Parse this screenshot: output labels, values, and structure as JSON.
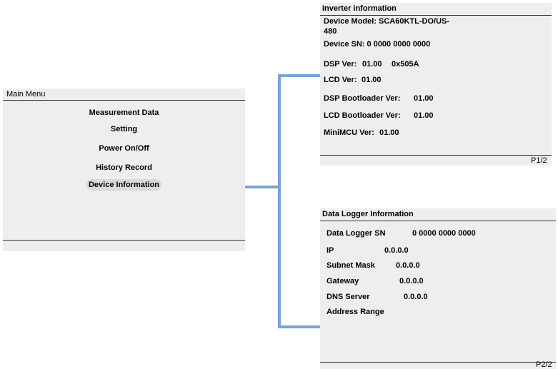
{
  "main_menu": {
    "title": "Main Menu",
    "items": [
      {
        "label": "Measurement Data"
      },
      {
        "label": "Setting"
      },
      {
        "label": "Power On/Off"
      },
      {
        "label": "History Record"
      },
      {
        "label": "Device Information",
        "selected": true
      }
    ]
  },
  "inverter_info": {
    "title": "Inverter information",
    "device_model_label": "Device Model: SCA60KTL-DO/US-",
    "device_model_cont": "480",
    "device_sn": "Device SN: 0 0000 0000 0000",
    "dsp_ver_label": "DSP Ver:",
    "dsp_ver_value": "01.00",
    "dsp_ver_code": "0x505A",
    "lcd_ver_label": "LCD Ver:",
    "lcd_ver_value": "01.00",
    "dsp_boot_label": "DSP Bootloader Ver:",
    "dsp_boot_value": "01.00",
    "lcd_boot_label": "LCD Bootloader Ver:",
    "lcd_boot_value": "01.00",
    "minimcu_label": "MiniMCU Ver:",
    "minimcu_value": "01.00",
    "page": "P1/2"
  },
  "logger_info": {
    "title": "Data Logger Information",
    "sn_label": "Data Logger SN",
    "sn_value": "0 0000 0000 0000",
    "ip_label": "IP",
    "ip_value": "0.0.0.0",
    "subnet_label": "Subnet Mask",
    "subnet_value": "0.0.0.0",
    "gateway_label": "Gateway",
    "gateway_value": "0.0.0.0",
    "dns_label": "DNS Server",
    "dns_value": "0.0.0.0",
    "address_label": "Address Range",
    "page": "P2/2"
  },
  "colors": {
    "panel_bg": "#eeeeee",
    "connector": "#7aa3d6",
    "selected_bg": "#d9d9d9"
  }
}
